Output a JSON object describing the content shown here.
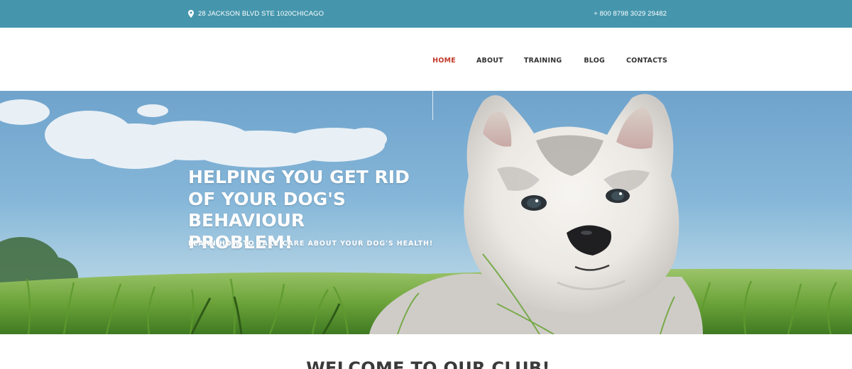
{
  "topbar": {
    "address": "28 JACKSON BLVD STE 1020CHICAGO",
    "address_icon": "map-pin-icon",
    "phone": "+ 800 8798 3029 29482"
  },
  "nav": {
    "items": [
      {
        "label": "HOME",
        "active": true
      },
      {
        "label": "ABOUT",
        "active": false
      },
      {
        "label": "TRAINING",
        "active": false
      },
      {
        "label": "BLOG",
        "active": false
      },
      {
        "label": "CONTACTS",
        "active": false
      }
    ]
  },
  "hero": {
    "headline_line1": "HELPING YOU GET RID",
    "headline_line2": "OF YOUR DOG'S BEHAVIOUR",
    "headline_line3": "PROBLEM!",
    "subline": "LEARN HOW TO TAKE CARE ABOUT YOUR DOG'S HEALTH!"
  },
  "welcome": {
    "title": "WELCOME TO OUR CLUB!"
  },
  "colors": {
    "topbar_bg": "#4596ad",
    "nav_active": "#c23a2b",
    "nav_text": "#333333",
    "headline_text": "#ffffff"
  }
}
